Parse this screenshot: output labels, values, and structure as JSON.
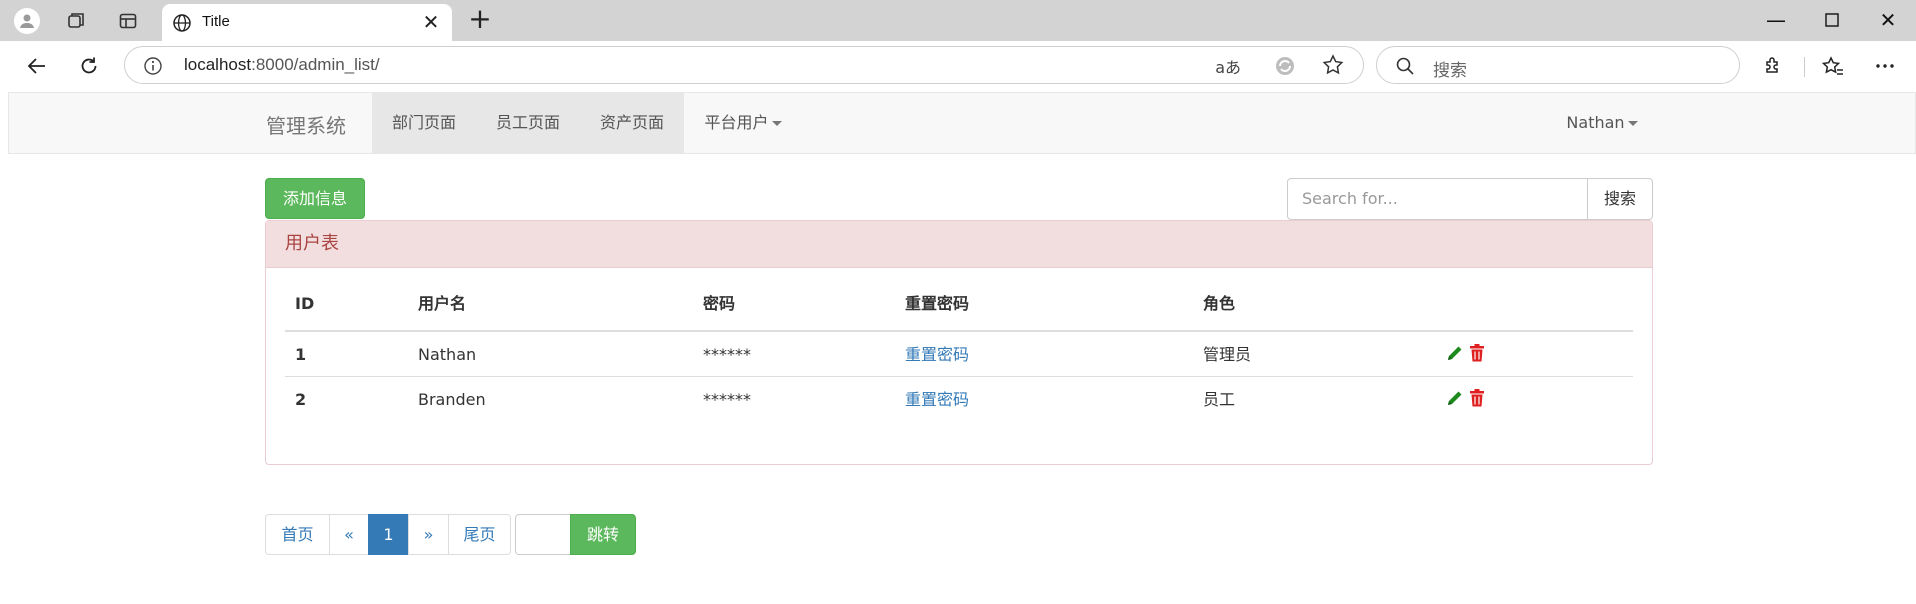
{
  "browser": {
    "tab_title": "Title",
    "url_host": "localhost",
    "url_rest": ":8000/admin_list/",
    "read_aloud": "aあ",
    "search_placeholder": "搜索"
  },
  "navbar": {
    "brand": "管理系统",
    "items": [
      {
        "label": "部门页面"
      },
      {
        "label": "员工页面"
      },
      {
        "label": "资产页面"
      },
      {
        "label": "平台用户"
      }
    ],
    "user": "Nathan"
  },
  "toolbar": {
    "add_label": "添加信息",
    "search_placeholder": "Search for...",
    "search_button": "搜索"
  },
  "panel": {
    "title": "用户表",
    "columns": [
      "ID",
      "用户名",
      "密码",
      "重置密码",
      "角色"
    ],
    "rows": [
      {
        "id": "1",
        "username": "Nathan",
        "password": "******",
        "reset": "重置密码",
        "role": "管理员"
      },
      {
        "id": "2",
        "username": "Branden",
        "password": "******",
        "reset": "重置密码",
        "role": "员工"
      }
    ]
  },
  "pagination": {
    "first": "首页",
    "prev": "«",
    "current": "1",
    "next": "»",
    "last": "尾页",
    "go": "跳转"
  },
  "colors": {
    "success": "#5cb85c",
    "primary": "#337ab7",
    "danger_bg": "#f2dede",
    "danger_text": "#a94442",
    "edit_icon": "#1e8a1e",
    "delete_icon": "#e02020"
  }
}
